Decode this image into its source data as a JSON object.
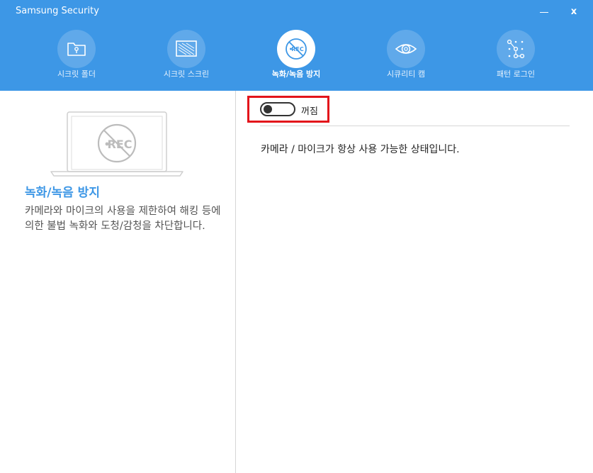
{
  "window": {
    "title": "Samsung Security",
    "close_label": "x"
  },
  "tabs": [
    {
      "label": "시크릿 폴더",
      "icon": "folder-key-icon"
    },
    {
      "label": "시크릿 스크린",
      "icon": "privacy-screen-icon"
    },
    {
      "label": "녹화/녹음 방지",
      "icon": "no-rec-icon"
    },
    {
      "label": "시큐리티 캠",
      "icon": "eye-camera-icon"
    },
    {
      "label": "패턴 로그인",
      "icon": "pattern-icon"
    }
  ],
  "active_tab": 2,
  "feature": {
    "title": "녹화/녹음 방지",
    "description": "카메라와 마이크의 사용을 제한하여 해킹 등에 의한 불법 녹화와 도청/감청을 차단합니다."
  },
  "toggle": {
    "label": "꺼짐",
    "state": "off"
  },
  "status": {
    "text": "카메라 / 마이크가 항상 사용 가능한 상태입니다."
  },
  "colors": {
    "header": "#3d97e6",
    "accent": "#3d97e6",
    "highlight": "#e3141b"
  }
}
